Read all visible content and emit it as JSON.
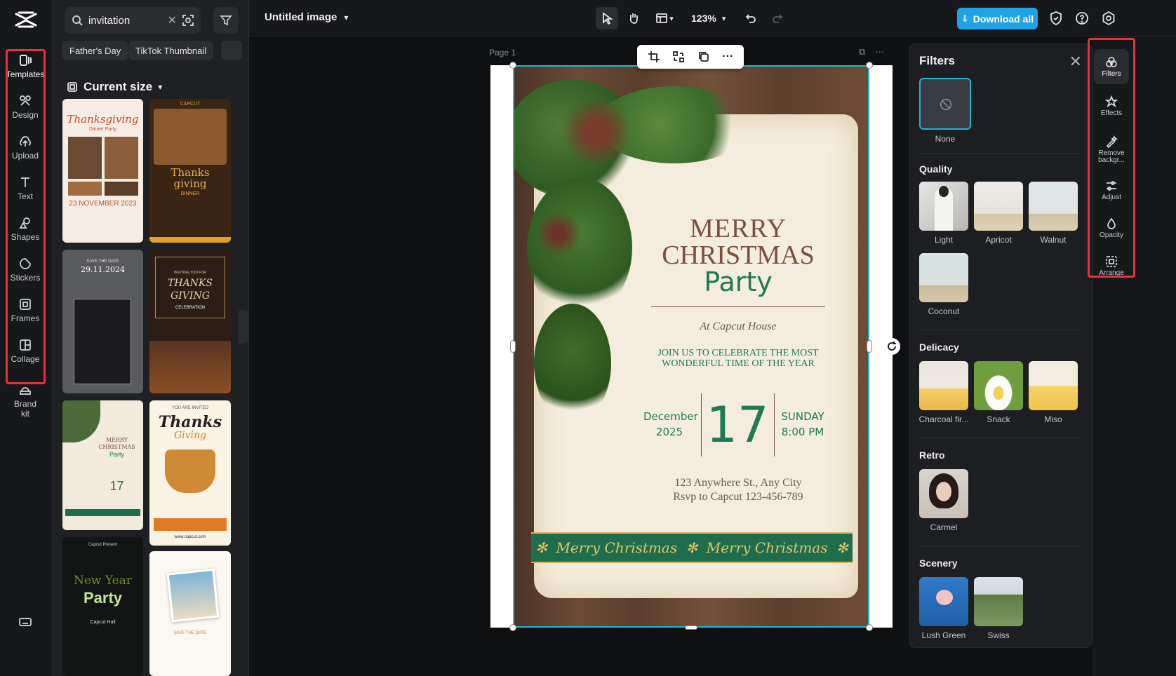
{
  "left_rail": {
    "items": [
      {
        "label": "Templates",
        "icon": "templates-icon"
      },
      {
        "label": "Design",
        "icon": "design-icon"
      },
      {
        "label": "Upload",
        "icon": "upload-icon"
      },
      {
        "label": "Text",
        "icon": "text-icon"
      },
      {
        "label": "Shapes",
        "icon": "shapes-icon"
      },
      {
        "label": "Stickers",
        "icon": "stickers-icon"
      },
      {
        "label": "Frames",
        "icon": "frames-icon"
      },
      {
        "label": "Collage",
        "icon": "collage-icon"
      },
      {
        "label": "Brand kit",
        "icon": "brand-kit-icon"
      }
    ]
  },
  "templates_panel": {
    "search_value": "invitation",
    "chips": [
      "Father's Day",
      "TikTok Thumbnail"
    ],
    "section_title": "Current size",
    "thumbs": {
      "t1": {
        "line1": "Thanksgiving",
        "line2": "Dinner Party",
        "line3": "23 NOVEMBER 2023"
      },
      "t2": {
        "line1": "CAPCUT",
        "line2": "Thanks",
        "line3": "giving",
        "line4": "DINNER"
      },
      "t3": {
        "line1": "SAVE THE DATE",
        "line2": "29.11.2024"
      },
      "t4": {
        "line1": "INVITING YOU FOR",
        "line2": "THANKS",
        "line3": "GIVING",
        "line4": "CELEBRATION"
      },
      "t5": {
        "line1": "MERRY",
        "line2": "CHRISTMAS",
        "line3": "Party",
        "line4": "17"
      },
      "t6": {
        "line1": "YOU ARE INVITED",
        "line2": "Thanks",
        "line3": "Giving",
        "line4": "www.capcut.com"
      },
      "t7": {
        "line1": "Capcut Present",
        "line2": "New Year",
        "line3": "Party",
        "line4": "Capcut Hall"
      },
      "t8": {
        "line1": "SAVE THE DATE"
      }
    }
  },
  "topbar": {
    "doc_title": "Untitled image",
    "zoom": "123%",
    "download_label": "Download all"
  },
  "canvas": {
    "page_label": "Page 1",
    "poster": {
      "merry": "MERRY",
      "christmas": "CHRISTMAS",
      "party": "Party",
      "venue": "At Capcut House",
      "join_line1": "JOIN US TO CELEBRATE THE MOST",
      "join_line2": "WONDERFUL TIME OF THE YEAR",
      "month": "December",
      "year": "2025",
      "day": "17",
      "weekday": "SUNDAY",
      "time": "8:00 PM",
      "address": "123 Anywhere St., Any City",
      "rsvp": "Rsvp to Capcut 123-456-789",
      "banner_text": "Merry Christmas"
    }
  },
  "filters_panel": {
    "title": "Filters",
    "none_label": "None",
    "categories": {
      "quality": {
        "title": "Quality",
        "items": [
          "Light",
          "Apricot",
          "Walnut",
          "Coconut"
        ]
      },
      "delicacy": {
        "title": "Delicacy",
        "items": [
          "Charcoal fir...",
          "Snack",
          "Miso"
        ]
      },
      "retro": {
        "title": "Retro",
        "items": [
          "Carmel"
        ]
      },
      "scenery": {
        "title": "Scenery",
        "items": [
          "Lush Green",
          "Swiss"
        ]
      }
    }
  },
  "right_rail": {
    "items": [
      {
        "label": "Filters",
        "icon": "filters-icon"
      },
      {
        "label": "Effects",
        "icon": "effects-icon"
      },
      {
        "label": "Remove backgr...",
        "icon": "remove-background-icon"
      },
      {
        "label": "Adjust",
        "icon": "adjust-icon"
      },
      {
        "label": "Opacity",
        "icon": "opacity-icon"
      },
      {
        "label": "Arrange",
        "icon": "arrange-icon"
      }
    ]
  }
}
